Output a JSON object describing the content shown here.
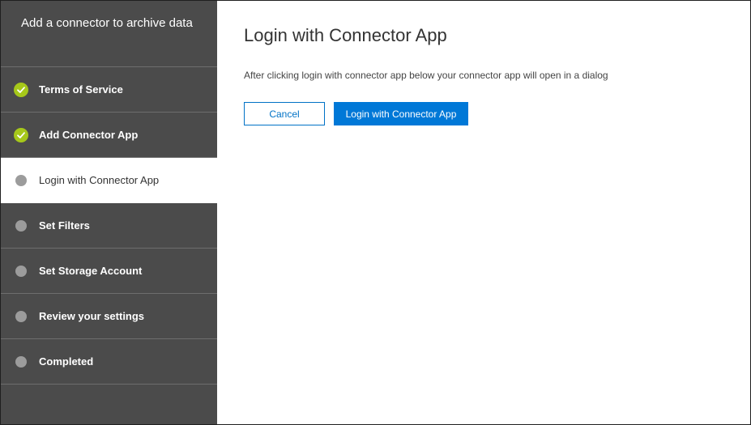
{
  "sidebar": {
    "title": "Add a connector to archive data",
    "steps": [
      {
        "label": "Terms of Service",
        "status": "complete"
      },
      {
        "label": "Add Connector App",
        "status": "complete"
      },
      {
        "label": "Login with Connector App",
        "status": "current"
      },
      {
        "label": "Set Filters",
        "status": "pending"
      },
      {
        "label": "Set Storage Account",
        "status": "pending"
      },
      {
        "label": "Review your settings",
        "status": "pending"
      },
      {
        "label": "Completed",
        "status": "pending"
      }
    ]
  },
  "main": {
    "title": "Login with Connector App",
    "instructions": "After clicking login with connector app below your connector app will open in a dialog",
    "cancel_label": "Cancel",
    "login_label": "Login with Connector App"
  },
  "colors": {
    "sidebar_bg": "#4b4b4b",
    "check_green": "#a6c81a",
    "primary_blue": "#0078d7",
    "pending_dot": "#9c9c9c"
  },
  "icons": {
    "complete": "checkmark-circle-icon",
    "pending": "circle-dot-icon"
  }
}
